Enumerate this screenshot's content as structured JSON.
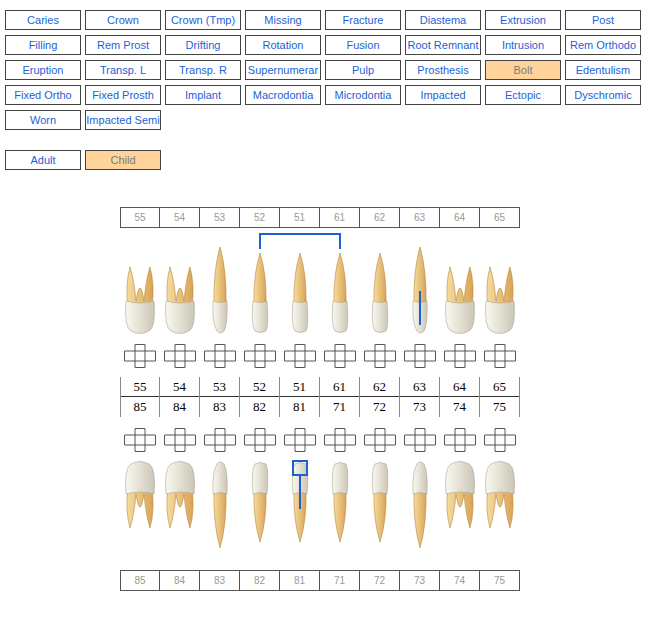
{
  "tools": [
    {
      "label": "Caries",
      "selected": false
    },
    {
      "label": "Crown",
      "selected": false
    },
    {
      "label": "Crown (Tmp)",
      "selected": false
    },
    {
      "label": "Missing",
      "selected": false
    },
    {
      "label": "Fracture",
      "selected": false
    },
    {
      "label": "Diastema",
      "selected": false
    },
    {
      "label": "Extrusion",
      "selected": false
    },
    {
      "label": "Post",
      "selected": false
    },
    {
      "label": "Filling",
      "selected": false
    },
    {
      "label": "Rem Prost",
      "selected": false
    },
    {
      "label": "Drifting",
      "selected": false
    },
    {
      "label": "Rotation",
      "selected": false
    },
    {
      "label": "Fusion",
      "selected": false
    },
    {
      "label": "Root Remnant",
      "selected": false
    },
    {
      "label": "Intrusion",
      "selected": false
    },
    {
      "label": "Rem Orthodo",
      "selected": false
    },
    {
      "label": "Eruption",
      "selected": false
    },
    {
      "label": "Transp. L",
      "selected": false
    },
    {
      "label": "Transp. R",
      "selected": false
    },
    {
      "label": "Supernumerar",
      "selected": false
    },
    {
      "label": "Pulp",
      "selected": false
    },
    {
      "label": "Prosthesis",
      "selected": false
    },
    {
      "label": "Bolt",
      "selected": true
    },
    {
      "label": "Edentulism",
      "selected": false
    },
    {
      "label": "Fixed Ortho",
      "selected": false
    },
    {
      "label": "Fixed Prosth",
      "selected": false
    },
    {
      "label": "Implant",
      "selected": false
    },
    {
      "label": "Macrodontia",
      "selected": false
    },
    {
      "label": "Microdontia",
      "selected": false
    },
    {
      "label": "Impacted",
      "selected": false
    },
    {
      "label": "Ectopic",
      "selected": false
    },
    {
      "label": "Dyschromic",
      "selected": false
    },
    {
      "label": "Worn",
      "selected": false
    },
    {
      "label": "Impacted Semi",
      "selected": false
    }
  ],
  "dentition": [
    {
      "label": "Adult",
      "selected": false
    },
    {
      "label": "Child",
      "selected": true
    }
  ],
  "upper": [
    {
      "number": "55",
      "kind": "molar",
      "annotation": "none"
    },
    {
      "number": "54",
      "kind": "molar",
      "annotation": "none"
    },
    {
      "number": "53",
      "kind": "canine",
      "annotation": "none"
    },
    {
      "number": "52",
      "kind": "incisor",
      "annotation": "none"
    },
    {
      "number": "51",
      "kind": "incisor",
      "annotation": "none"
    },
    {
      "number": "61",
      "kind": "incisor",
      "annotation": "none"
    },
    {
      "number": "62",
      "kind": "incisor",
      "annotation": "none"
    },
    {
      "number": "63",
      "kind": "canine",
      "annotation": "post"
    },
    {
      "number": "64",
      "kind": "molar",
      "annotation": "none"
    },
    {
      "number": "65",
      "kind": "molar",
      "annotation": "none"
    }
  ],
  "lower": [
    {
      "number": "85",
      "kind": "molar",
      "annotation": "none"
    },
    {
      "number": "84",
      "kind": "molar",
      "annotation": "none"
    },
    {
      "number": "83",
      "kind": "canine",
      "annotation": "none"
    },
    {
      "number": "82",
      "kind": "incisor",
      "annotation": "none"
    },
    {
      "number": "81",
      "kind": "incisor",
      "annotation": "bolt"
    },
    {
      "number": "71",
      "kind": "incisor",
      "annotation": "none"
    },
    {
      "number": "72",
      "kind": "incisor",
      "annotation": "none"
    },
    {
      "number": "73",
      "kind": "canine",
      "annotation": "none"
    },
    {
      "number": "74",
      "kind": "molar",
      "annotation": "none"
    },
    {
      "number": "75",
      "kind": "molar",
      "annotation": "none"
    }
  ],
  "bridges": [
    {
      "teeth": [
        "52",
        "51",
        "61"
      ]
    }
  ]
}
